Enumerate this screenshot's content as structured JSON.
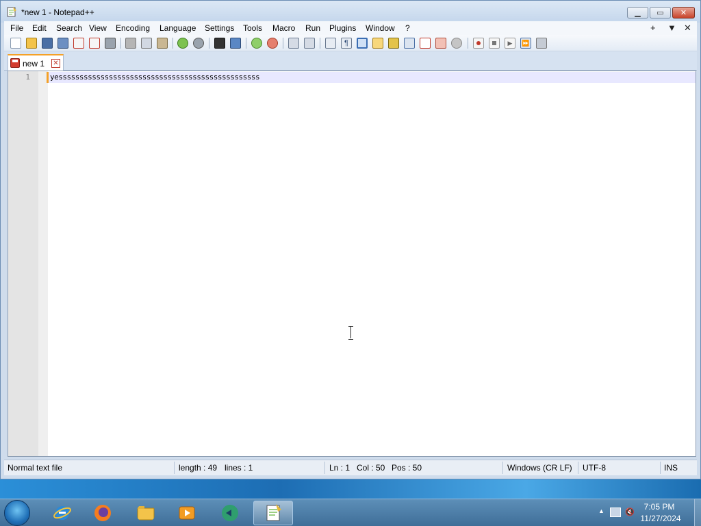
{
  "window": {
    "title": "*new 1 - Notepad++",
    "controls": {
      "minimize": "▁",
      "maximize": "▭",
      "close": "✕"
    }
  },
  "menubar": {
    "items": [
      "File",
      "Edit",
      "Search",
      "View",
      "Encoding",
      "Language",
      "Settings",
      "Tools",
      "Macro",
      "Run",
      "Plugins",
      "Window",
      "?"
    ],
    "right": [
      "+",
      "▼",
      "✕"
    ]
  },
  "toolbar": {
    "icons": [
      "new-file",
      "open-file",
      "save",
      "save-all",
      "close",
      "close-all",
      "print",
      "cut",
      "copy",
      "paste",
      "undo",
      "redo",
      "find",
      "replace",
      "zoom-in",
      "zoom-out",
      "sync-vertical",
      "sync-horizontal",
      "word-wrap",
      "show-all-chars",
      "indent-guide",
      "udl",
      "doc-map",
      "function-list",
      "folder-workspace",
      "monitor",
      "record-macro",
      "stop-record",
      "playback",
      "run-macro-multiple",
      "save-macro"
    ]
  },
  "tab": {
    "label": "new 1",
    "close": "✕"
  },
  "editor": {
    "line_number": "1",
    "text": "yessssssssssssssssssssssssssssssssssssssssssssssss"
  },
  "statusbar": {
    "file_type": "Normal text file",
    "length": "length : 49",
    "lines": "lines : 1",
    "ln": "Ln : 1",
    "col": "Col : 50",
    "pos": "Pos : 50",
    "eol": "Windows (CR LF)",
    "encoding": "UTF-8",
    "mode": "INS"
  },
  "taskbar": {
    "apps": [
      "internet-explorer",
      "firefox",
      "file-explorer",
      "media-player",
      "remote-app",
      "notepad-plus-plus"
    ],
    "time": "7:05 PM",
    "date": "11/27/2024"
  },
  "colors": {
    "accent_tab": "#f4a128",
    "current_line": "#e8e8ff",
    "taskbar": "#3f6e98"
  }
}
